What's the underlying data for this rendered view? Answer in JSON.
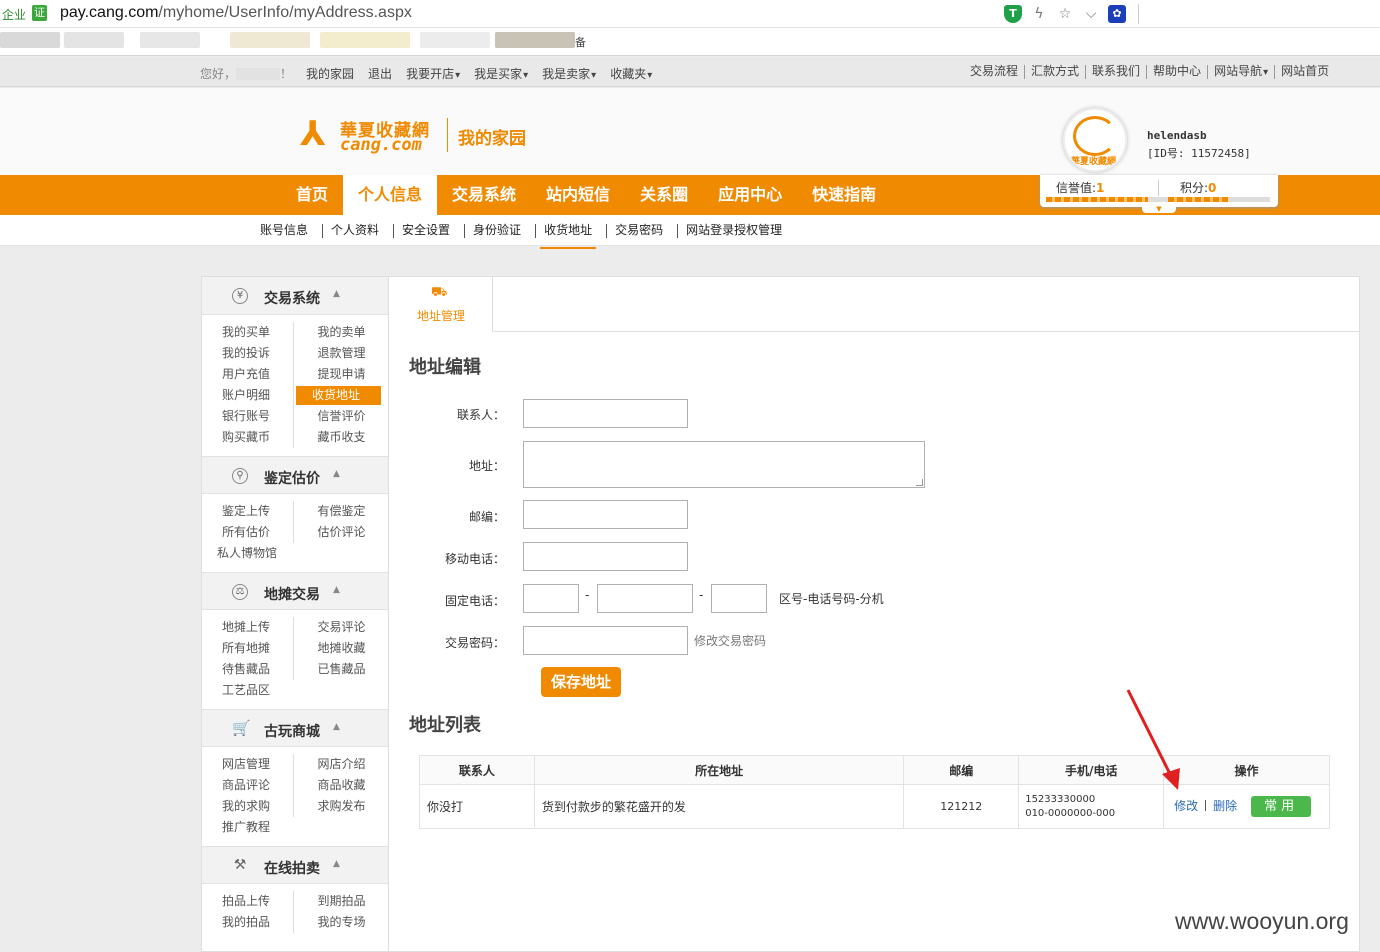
{
  "browser": {
    "enterprise_label": "企业",
    "cert_label": "证",
    "url_domain": "pay.cang.com",
    "url_path": "/myhome/UserInfo/myAddress.aspx",
    "bookmark_tail": "备"
  },
  "topbar": {
    "greeting": "您好，",
    "greeting_end": "！",
    "left_links": [
      "我的家园",
      "退出",
      "我要开店",
      "我是买家",
      "我是卖家",
      "收藏夹"
    ],
    "right_links": [
      "交易流程",
      "汇款方式",
      "联系我们",
      "帮助中心",
      "网站导航",
      "网站首页"
    ]
  },
  "header": {
    "logo_cn": "華夏收藏網",
    "logo_en": "cang.com",
    "home_title": "我的家园",
    "avatar_text": "華夏收藏網",
    "username": "helendasb",
    "user_id": "[ID号: 11572458]"
  },
  "mainnav": {
    "items": [
      "首页",
      "个人信息",
      "交易系统",
      "站内短信",
      "关系圈",
      "应用中心",
      "快速指南"
    ],
    "active_index": 1,
    "credit_label": "信誉值:",
    "credit_value": "1",
    "points_label": "积分:",
    "points_value": "0"
  },
  "subnav": {
    "items": [
      "账号信息",
      "个人资料",
      "安全设置",
      "身份验证",
      "收货地址",
      "交易密码",
      "网站登录授权管理"
    ],
    "active_index": 4
  },
  "sidebar": {
    "sections": [
      {
        "title": "交易系统",
        "icon": "yen-icon",
        "rows": [
          [
            "我的买单",
            "我的卖单"
          ],
          [
            "我的投诉",
            "退款管理"
          ],
          [
            "用户充值",
            "提现申请"
          ],
          [
            "账户明细",
            "收货地址"
          ],
          [
            "银行账号",
            "信誉评价"
          ],
          [
            "购买藏币",
            "藏币收支"
          ]
        ]
      },
      {
        "title": "鉴定估价",
        "icon": "magnifier-icon",
        "rows": [
          [
            "鉴定上传",
            "有偿鉴定"
          ],
          [
            "所有估价",
            "估价评论"
          ],
          [
            "私人博物馆",
            ""
          ]
        ]
      },
      {
        "title": "地摊交易",
        "icon": "scale-icon",
        "rows": [
          [
            "地摊上传",
            "交易评论"
          ],
          [
            "所有地摊",
            "地摊收藏"
          ],
          [
            "待售藏品",
            "已售藏品"
          ],
          [
            "工艺品区",
            ""
          ]
        ]
      },
      {
        "title": "古玩商城",
        "icon": "cart-icon",
        "rows": [
          [
            "网店管理",
            "网店介绍"
          ],
          [
            "商品评论",
            "商品收藏"
          ],
          [
            "我的求购",
            "求购发布"
          ],
          [
            "推广教程",
            ""
          ]
        ]
      },
      {
        "title": "在线拍卖",
        "icon": "gavel-icon",
        "rows": [
          [
            "拍品上传",
            "到期拍品"
          ],
          [
            "我的拍品",
            "我的专场"
          ]
        ]
      }
    ]
  },
  "content": {
    "tab_label": "地址管理",
    "edit_title": "地址编辑",
    "form": {
      "contact_label": "联系人：",
      "address_label": "地址：",
      "zip_label": "邮编：",
      "mobile_label": "移动电话：",
      "landline_label": "固定电话：",
      "landline_sep": "-",
      "landline_hint": "区号-电话号码-分机",
      "password_label": "交易密码：",
      "password_link": "修改交易密码",
      "save_button": "保存地址"
    },
    "list_title": "地址列表",
    "table": {
      "headers": [
        "联系人",
        "所在地址",
        "邮编",
        "手机/电话",
        "操作"
      ],
      "rows": [
        {
          "name": "你没打",
          "address": "货到付款步的繁花盛开的发",
          "zip": "121212",
          "mobile": "15233330000",
          "phone": "010-0000000-000",
          "edit": "修改",
          "delete": "删除",
          "default": "常用"
        }
      ]
    }
  },
  "watermark": "www.wooyun.org",
  "colors": {
    "brand_orange": "#f08a00",
    "button_green": "#4cb84c",
    "link_blue": "#2a6ab5",
    "annotation_red": "#e02020"
  }
}
